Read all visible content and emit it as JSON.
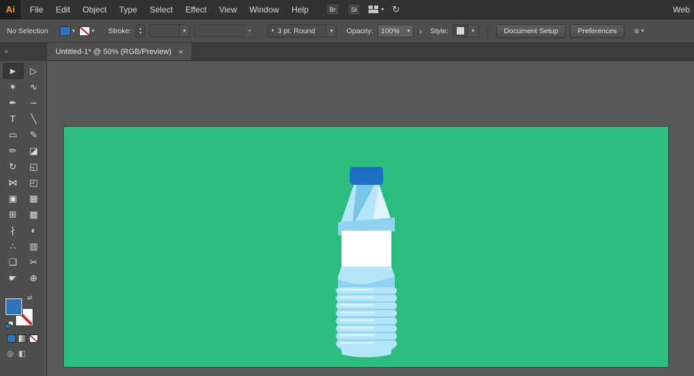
{
  "menu_bar": {
    "logo": "Ai",
    "items": [
      "File",
      "Edit",
      "Object",
      "Type",
      "Select",
      "Effect",
      "View",
      "Window",
      "Help"
    ],
    "bridge_label": "Br",
    "st_label": "St",
    "workspace_label": "Web"
  },
  "control_bar": {
    "selection_status": "No Selection",
    "stroke_label": "Stroke:",
    "stroke_width_value": "",
    "brush_bullet": "•",
    "brush_value": "3 pt. Round",
    "opacity_label": "Opacity:",
    "opacity_value": "100%",
    "style_label": "Style:",
    "document_setup": "Document Setup",
    "preferences": "Preferences"
  },
  "tab": {
    "title": "Untitled-1* @ 50% (RGB/Preview)",
    "close": "×"
  },
  "icons": {
    "collapse": "«",
    "chevron_down": "▾",
    "chevron_right": "›",
    "spinner_up": "▴",
    "spinner_down": "▾",
    "swap": "⇄",
    "sync": "↻",
    "align": "≡",
    "draw_mode": "◎",
    "screen_mode": "◧"
  },
  "tools": [
    {
      "name": "selection",
      "glyph": "►",
      "active": true
    },
    {
      "name": "direct-selection",
      "glyph": "▷"
    },
    {
      "name": "magic-wand",
      "glyph": "✶"
    },
    {
      "name": "lasso",
      "glyph": "∿"
    },
    {
      "name": "pen",
      "glyph": "✒"
    },
    {
      "name": "curvature",
      "glyph": "∽"
    },
    {
      "name": "type",
      "glyph": "T"
    },
    {
      "name": "line-segment",
      "glyph": "╲"
    },
    {
      "name": "rectangle",
      "glyph": "▭"
    },
    {
      "name": "paintbrush",
      "glyph": "✎"
    },
    {
      "name": "pencil",
      "glyph": "✏"
    },
    {
      "name": "eraser",
      "glyph": "◪"
    },
    {
      "name": "rotate",
      "glyph": "↻"
    },
    {
      "name": "scale",
      "glyph": "◱"
    },
    {
      "name": "width",
      "glyph": "⋈"
    },
    {
      "name": "free-transform",
      "glyph": "◰"
    },
    {
      "name": "shape-builder",
      "glyph": "▣"
    },
    {
      "name": "perspective-grid",
      "glyph": "▦"
    },
    {
      "name": "mesh",
      "glyph": "⊞"
    },
    {
      "name": "gradient",
      "glyph": "▩"
    },
    {
      "name": "eyedropper",
      "glyph": "∤"
    },
    {
      "name": "blend",
      "glyph": "◐"
    },
    {
      "name": "symbol-sprayer",
      "glyph": "∴"
    },
    {
      "name": "column-graph",
      "glyph": "▥"
    },
    {
      "name": "artboard",
      "glyph": "❏"
    },
    {
      "name": "slice",
      "glyph": "✂"
    },
    {
      "name": "hand",
      "glyph": "☛"
    },
    {
      "name": "zoom",
      "glyph": "⊕"
    }
  ],
  "colors": {
    "artboard": "#2ABD7D",
    "cap": "#1D6FC4",
    "bottle_light": "#B4E5F8",
    "bottle_mid": "#8FD2EF",
    "bottle_dark": "#7AC6E8",
    "bottle_highlight": "#DFF3FC",
    "label": "#FFFFFF",
    "fill_swatch": "#2D74BC"
  }
}
